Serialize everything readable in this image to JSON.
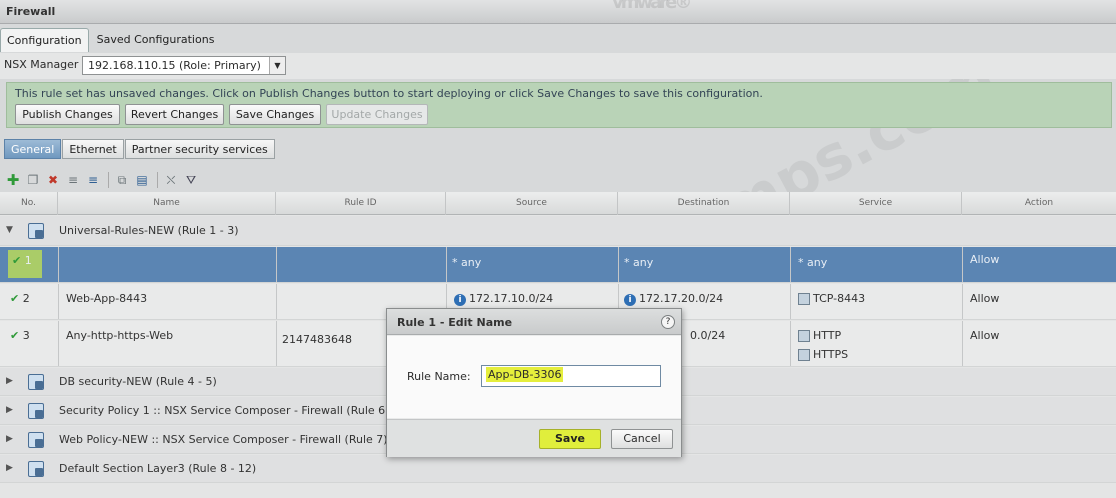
{
  "window": {
    "title": "Firewall"
  },
  "brand": {
    "logo_text": "vmware",
    "reg_mark": "®"
  },
  "watermark": {
    "text": "pass4dumps.com"
  },
  "top_tabs": [
    {
      "label": "Configuration"
    },
    {
      "label": "Saved Configurations"
    }
  ],
  "nsx": {
    "label": "NSX Manager",
    "selected": "192.168.110.15 (Role: Primary)"
  },
  "banner": {
    "message": "This rule set has unsaved changes. Click on Publish Changes button to start deploying or click Save Changes to save this configuration.",
    "buttons": {
      "publish": "Publish Changes",
      "revert": "Revert Changes",
      "save": "Save Changes",
      "update": "Update Changes"
    }
  },
  "sub_tabs": [
    {
      "label": "General"
    },
    {
      "label": "Ethernet"
    },
    {
      "label": "Partner security services"
    }
  ],
  "toolbar": {
    "icons": [
      "add-icon",
      "copy-icon",
      "delete-icon",
      "move-up-icon",
      "move-down-icon",
      "add-section-icon",
      "export-icon",
      "filter-clear-icon",
      "filter-icon"
    ]
  },
  "columns": {
    "no": "No.",
    "name": "Name",
    "rule_id": "Rule ID",
    "source": "Source",
    "destination": "Destination",
    "service": "Service",
    "action": "Action"
  },
  "sections": [
    {
      "title": "Universal-Rules-NEW (Rule 1 - 3)"
    },
    {
      "title": "DB security-NEW (Rule 4 - 5)"
    },
    {
      "title": "Security Policy 1 :: NSX Service Composer - Firewall (Rule 6)"
    },
    {
      "title": "Web Policy-NEW :: NSX Service Composer - Firewall (Rule 7)"
    },
    {
      "title": "Default Section Layer3 (Rule 8 - 12)"
    }
  ],
  "rules": [
    {
      "no": "1",
      "name": "",
      "rule_id": "",
      "source": "* any",
      "destination": "* any",
      "service": "* any",
      "service2": "",
      "action": "Allow"
    },
    {
      "no": "2",
      "name": "Web-App-8443",
      "rule_id": "",
      "source": "172.17.10.0/24",
      "destination": "172.17.20.0/24",
      "service": "TCP-8443",
      "service2": "",
      "action": "Allow"
    },
    {
      "no": "3",
      "name": "Any-http-https-Web",
      "rule_id": "2147483648",
      "source": "",
      "destination": "0.0/24",
      "service": "HTTP",
      "service2": "HTTPS",
      "action": "Allow"
    }
  ],
  "dialog": {
    "title": "Rule 1 - Edit Name",
    "help": "?",
    "field_label": "Rule Name:",
    "field_value": "App-DB-3306",
    "save_label": "Save",
    "cancel_label": "Cancel"
  },
  "colors": {
    "selected_row": "#5b85b3",
    "highlight": "#e0ee3c",
    "banner_bg": "#b9d3b7"
  }
}
